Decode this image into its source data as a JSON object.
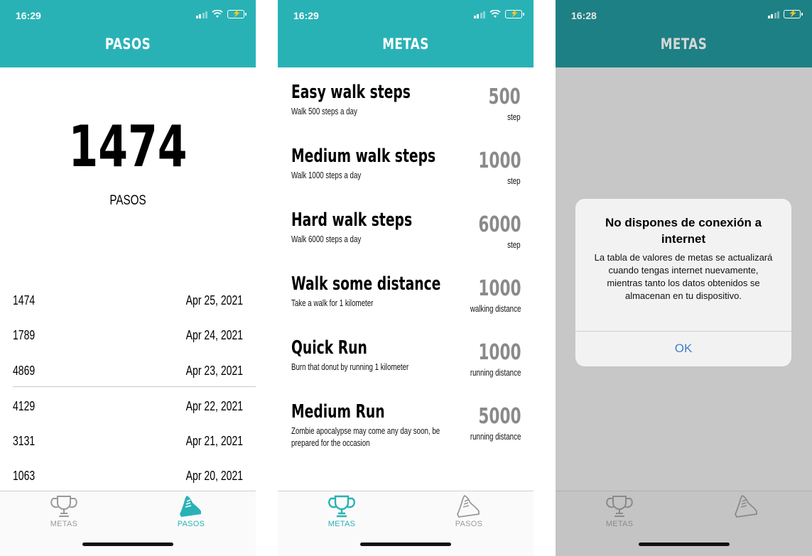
{
  "colors": {
    "header": "#29b2b6",
    "header_dim": "#1d8084",
    "accent": "#29b2b6",
    "inactive": "#9a9a9a",
    "link": "#3f7fcf"
  },
  "screen1": {
    "time": "16:29",
    "title": "PASOS",
    "today_steps": "1474",
    "today_label": "PASOS",
    "history": [
      {
        "value": "1474",
        "date": "Apr 25, 2021"
      },
      {
        "value": "1789",
        "date": "Apr 24, 2021"
      },
      {
        "value": "4869",
        "date": "Apr 23, 2021"
      },
      {
        "value": "4129",
        "date": "Apr 22, 2021"
      },
      {
        "value": "3131",
        "date": "Apr 21, 2021"
      },
      {
        "value": "1063",
        "date": "Apr 20, 2021"
      }
    ],
    "tabs": [
      {
        "label": "METAS",
        "icon": "trophy-icon",
        "active": false
      },
      {
        "label": "PASOS",
        "icon": "shoe-icon",
        "active": true
      }
    ]
  },
  "screen2": {
    "time": "16:29",
    "title": "METAS",
    "goals": [
      {
        "title": "Easy walk steps",
        "desc": "Walk 500 steps a day",
        "value": "500",
        "unit": "step"
      },
      {
        "title": "Medium walk steps",
        "desc": "Walk 1000 steps a day",
        "value": "1000",
        "unit": "step"
      },
      {
        "title": "Hard walk steps",
        "desc": "Walk 6000 steps a day",
        "value": "6000",
        "unit": "step"
      },
      {
        "title": "Walk some distance",
        "desc": "Take a walk for 1 kilometer",
        "value": "1000",
        "unit": "walking distance"
      },
      {
        "title": "Quick Run",
        "desc": "Burn that donut by running 1 kilometer",
        "value": "1000",
        "unit": "running distance"
      },
      {
        "title": "Medium Run",
        "desc": "Zombie apocalypse may come any day soon, be prepared for the occasion",
        "value": "5000",
        "unit": "running distance"
      }
    ],
    "tabs": [
      {
        "label": "METAS",
        "icon": "trophy-icon",
        "active": true
      },
      {
        "label": "PASOS",
        "icon": "shoe-icon",
        "active": false
      }
    ]
  },
  "screen3": {
    "time": "16:28",
    "title": "METAS",
    "alert": {
      "title": "No dispones de conexión a internet",
      "message": "La tabla de valores de metas se actualizará cuando tengas internet nuevamente, mientras tanto los datos obtenidos se almacenan en tu dispositivo.",
      "ok": "OK"
    },
    "tabs": [
      {
        "label": "METAS",
        "icon": "trophy-icon"
      },
      {
        "label": "",
        "icon": "shoe-icon"
      }
    ]
  }
}
